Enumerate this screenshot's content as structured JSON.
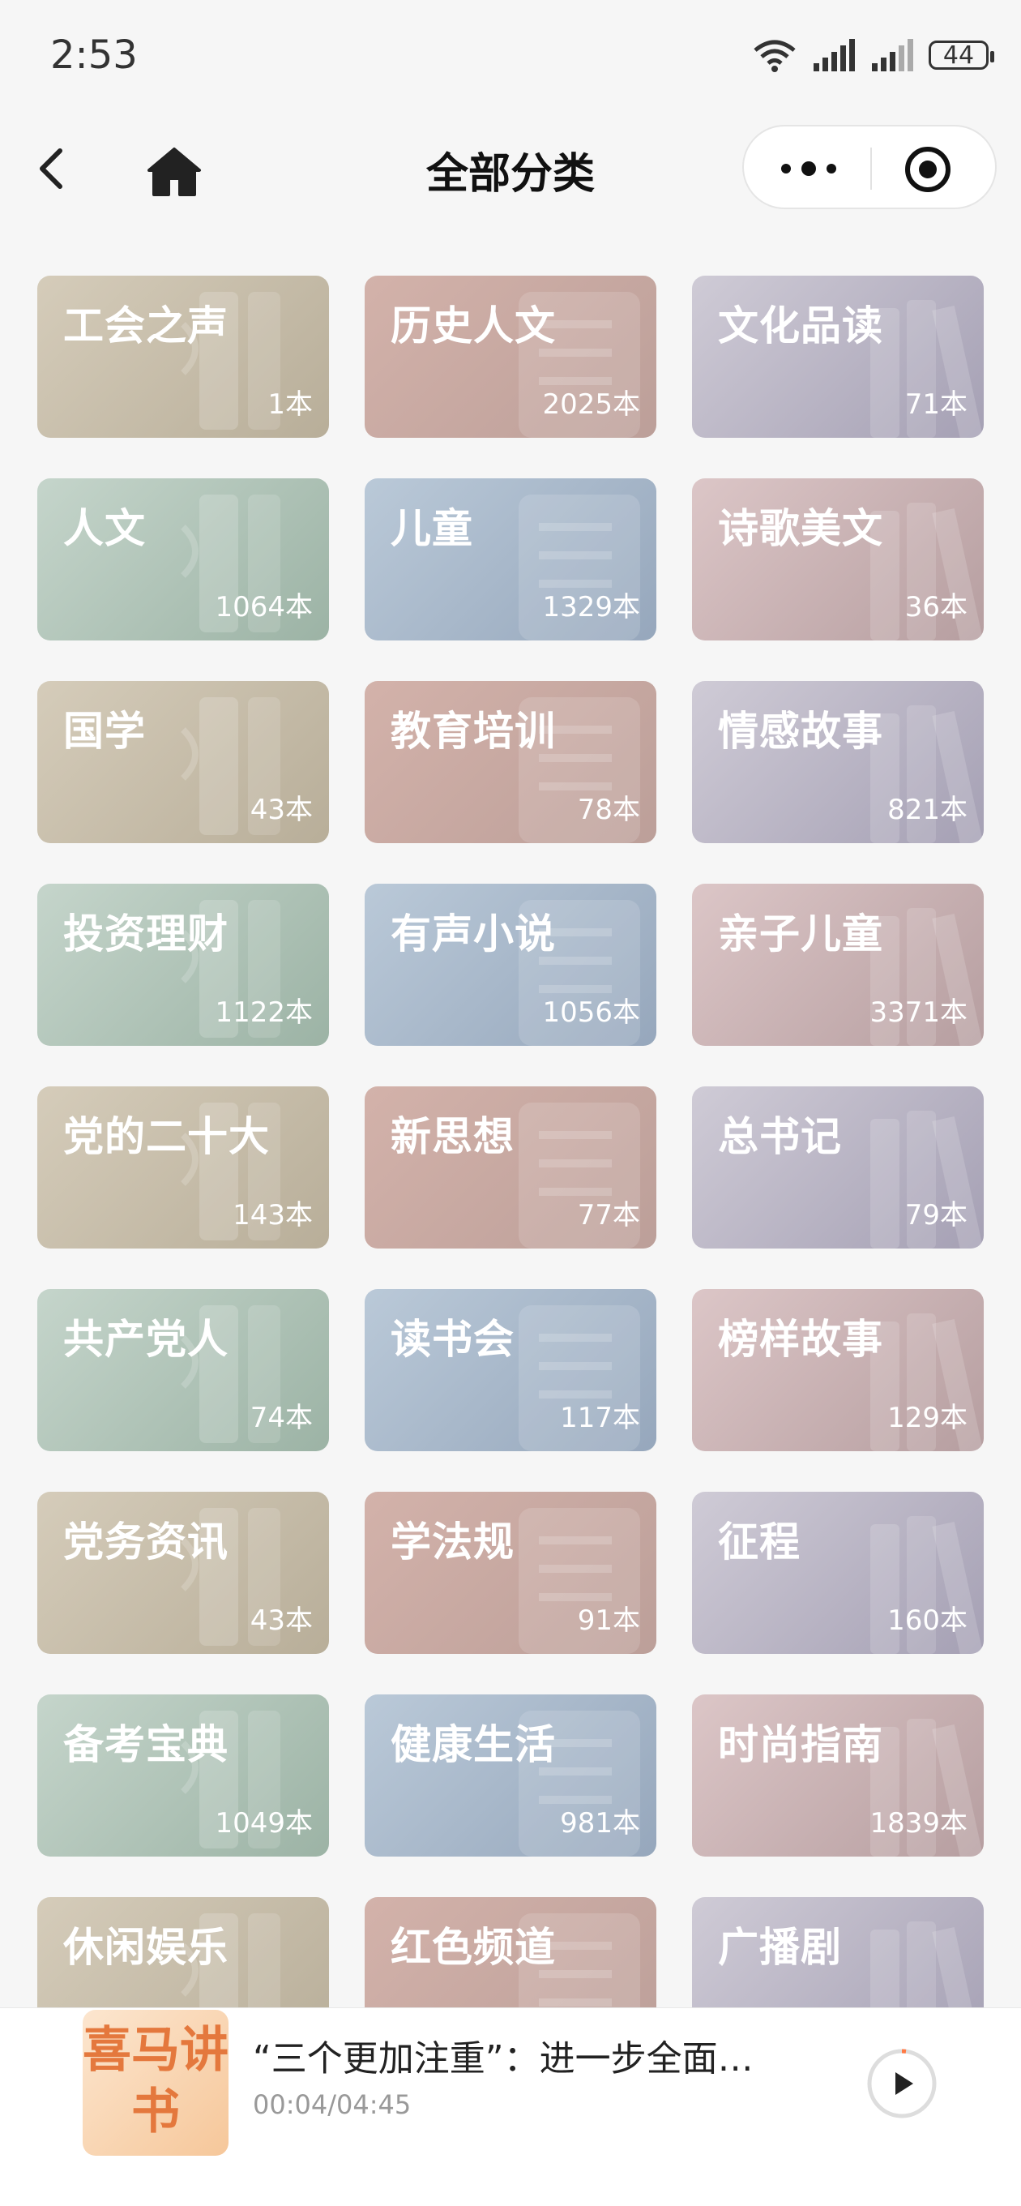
{
  "status": {
    "time": "2:53",
    "battery": "44"
  },
  "nav": {
    "title": "全部分类"
  },
  "categories": [
    {
      "name": "工会之声",
      "count": "1本"
    },
    {
      "name": "历史人文",
      "count": "2025本"
    },
    {
      "name": "文化品读",
      "count": "71本"
    },
    {
      "name": "人文",
      "count": "1064本"
    },
    {
      "name": "儿童",
      "count": "1329本"
    },
    {
      "name": "诗歌美文",
      "count": "36本"
    },
    {
      "name": "国学",
      "count": "43本"
    },
    {
      "name": "教育培训",
      "count": "78本"
    },
    {
      "name": "情感故事",
      "count": "821本"
    },
    {
      "name": "投资理财",
      "count": "1122本"
    },
    {
      "name": "有声小说",
      "count": "1056本"
    },
    {
      "name": "亲子儿童",
      "count": "3371本"
    },
    {
      "name": "党的二十大",
      "count": "143本"
    },
    {
      "name": "新思想",
      "count": "77本"
    },
    {
      "name": "总书记",
      "count": "79本"
    },
    {
      "name": "共产党人",
      "count": "74本"
    },
    {
      "name": "读书会",
      "count": "117本"
    },
    {
      "name": "榜样故事",
      "count": "129本"
    },
    {
      "name": "党务资讯",
      "count": "43本"
    },
    {
      "name": "学法规",
      "count": "91本"
    },
    {
      "name": "征程",
      "count": "160本"
    },
    {
      "name": "备考宝典",
      "count": "1049本"
    },
    {
      "name": "健康生活",
      "count": "981本"
    },
    {
      "name": "时尚指南",
      "count": "1839本"
    },
    {
      "name": "休闲娱乐",
      "count": ""
    },
    {
      "name": "红色频道",
      "count": ""
    },
    {
      "name": "广播剧",
      "count": ""
    }
  ],
  "player": {
    "cover_text": "喜马讲书",
    "title": "“三个更加注重”：进一步全面…",
    "time": "00:04/04:45"
  }
}
